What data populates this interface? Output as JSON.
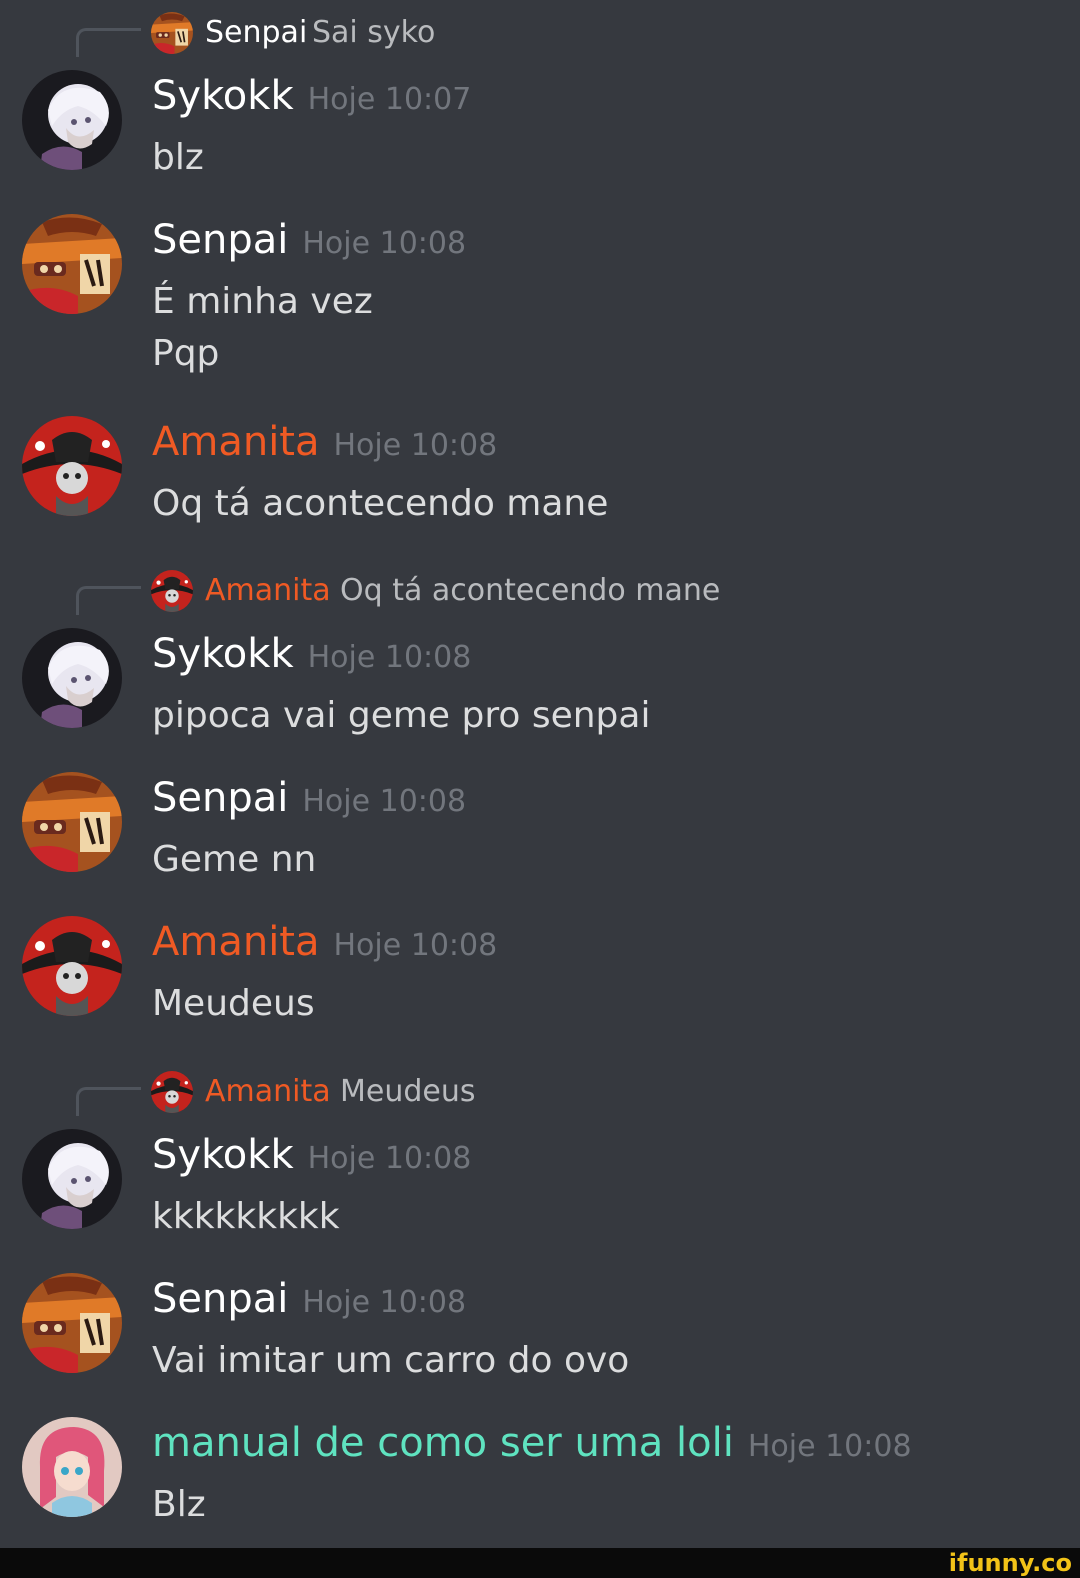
{
  "colors": {
    "background": "#36393f",
    "timestamp": "#72767d",
    "message_text": "#dcddde",
    "sykokk": "#ffffff",
    "senpai": "#ffffff",
    "amanita": "#f05a24",
    "loli": "#5fe3c0",
    "watermark": "#f2c318"
  },
  "replies": [
    {
      "author": "Senpai",
      "text": "Sai syko",
      "avatar": "senpai-avatar"
    },
    {
      "author": "Amanita",
      "text": "Oq tá acontecendo mane",
      "avatar": "amanita-avatar"
    },
    {
      "author": "Amanita",
      "text": "Meudeus",
      "avatar": "amanita-avatar"
    }
  ],
  "messages": [
    {
      "author": "Sykokk",
      "timestamp": "Hoje 10:07",
      "lines": [
        "blz"
      ],
      "avatar": "sykokk-avatar"
    },
    {
      "author": "Senpai",
      "timestamp": "Hoje 10:08",
      "lines": [
        "É minha vez",
        "Pqp"
      ],
      "avatar": "senpai-avatar"
    },
    {
      "author": "Amanita",
      "timestamp": "Hoje 10:08",
      "lines": [
        "Oq tá acontecendo mane"
      ],
      "avatar": "amanita-avatar"
    },
    {
      "author": "Sykokk",
      "timestamp": "Hoje 10:08",
      "lines": [
        "pipoca vai geme pro senpai"
      ],
      "avatar": "sykokk-avatar"
    },
    {
      "author": "Senpai",
      "timestamp": "Hoje 10:08",
      "lines": [
        "Geme nn"
      ],
      "avatar": "senpai-avatar"
    },
    {
      "author": "Amanita",
      "timestamp": "Hoje 10:08",
      "lines": [
        "Meudeus"
      ],
      "avatar": "amanita-avatar"
    },
    {
      "author": "Sykokk",
      "timestamp": "Hoje 10:08",
      "lines": [
        "kkkkkkkkk"
      ],
      "avatar": "sykokk-avatar"
    },
    {
      "author": "Senpai",
      "timestamp": "Hoje 10:08",
      "lines": [
        "Vai imitar um carro do ovo"
      ],
      "avatar": "senpai-avatar"
    },
    {
      "author": "manual de como ser uma loli",
      "timestamp": "Hoje 10:08",
      "lines": [
        "Blz"
      ],
      "avatar": "loli-avatar"
    }
  ],
  "watermark": "ifunny.co"
}
